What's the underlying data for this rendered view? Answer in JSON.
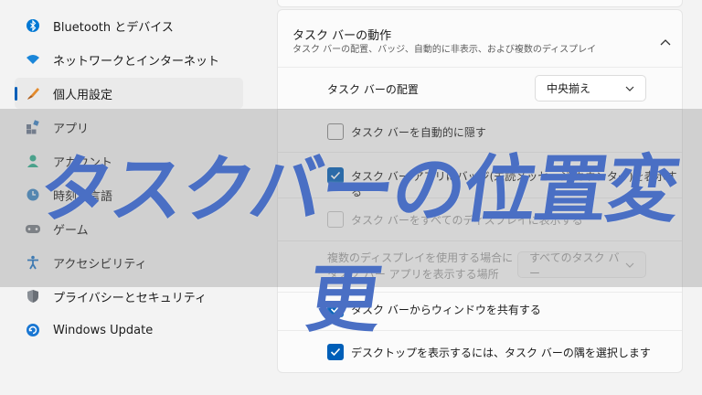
{
  "sidebar": {
    "items": [
      {
        "label": "Bluetooth とデバイス",
        "icon": "bluetooth-icon"
      },
      {
        "label": "ネットワークとインターネット",
        "icon": "wifi-icon"
      },
      {
        "label": "個人用設定",
        "icon": "brush-icon",
        "selected": true
      },
      {
        "label": "アプリ",
        "icon": "apps-icon"
      },
      {
        "label": "アカウント",
        "icon": "account-icon"
      },
      {
        "label": "時刻と言語",
        "icon": "globe-clock-icon"
      },
      {
        "label": "ゲーム",
        "icon": "gamepad-icon"
      },
      {
        "label": "アクセシビリティ",
        "icon": "accessibility-icon"
      },
      {
        "label": "プライバシーとセキュリティ",
        "icon": "shield-icon"
      },
      {
        "label": "Windows Update",
        "icon": "update-icon"
      }
    ]
  },
  "section": {
    "title": "タスク バーの動作",
    "subtitle": "タスク バーの配置、バッジ、自動的に非表示、および複数のディスプレイ"
  },
  "settings": {
    "alignment_label": "タスク バーの配置",
    "alignment_value": "中央揃え",
    "auto_hide_label": "タスク バーを自動的に隠す",
    "badges_label": "タスク バー アプリにバッジ(未読メッセージ カウンター)を表示する",
    "all_displays_label": "タスク バーをすべてのディスプレイに表示する",
    "multi_display_label_line1": "複数のディスプレイを使用する場合に",
    "multi_display_label_line2": "タスク バー アプリを表示する場所",
    "multi_display_value": "すべてのタスク バー",
    "share_window_label": "タスク バーからウィンドウを共有する",
    "desktop_corner_label": "デスクトップを表示するには、タスク バーの隅を選択します"
  },
  "overlay": {
    "title": "タスクバーの位置変更"
  },
  "colors": {
    "accent": "#005fb8",
    "overlay_text": "#4a6fc4"
  }
}
